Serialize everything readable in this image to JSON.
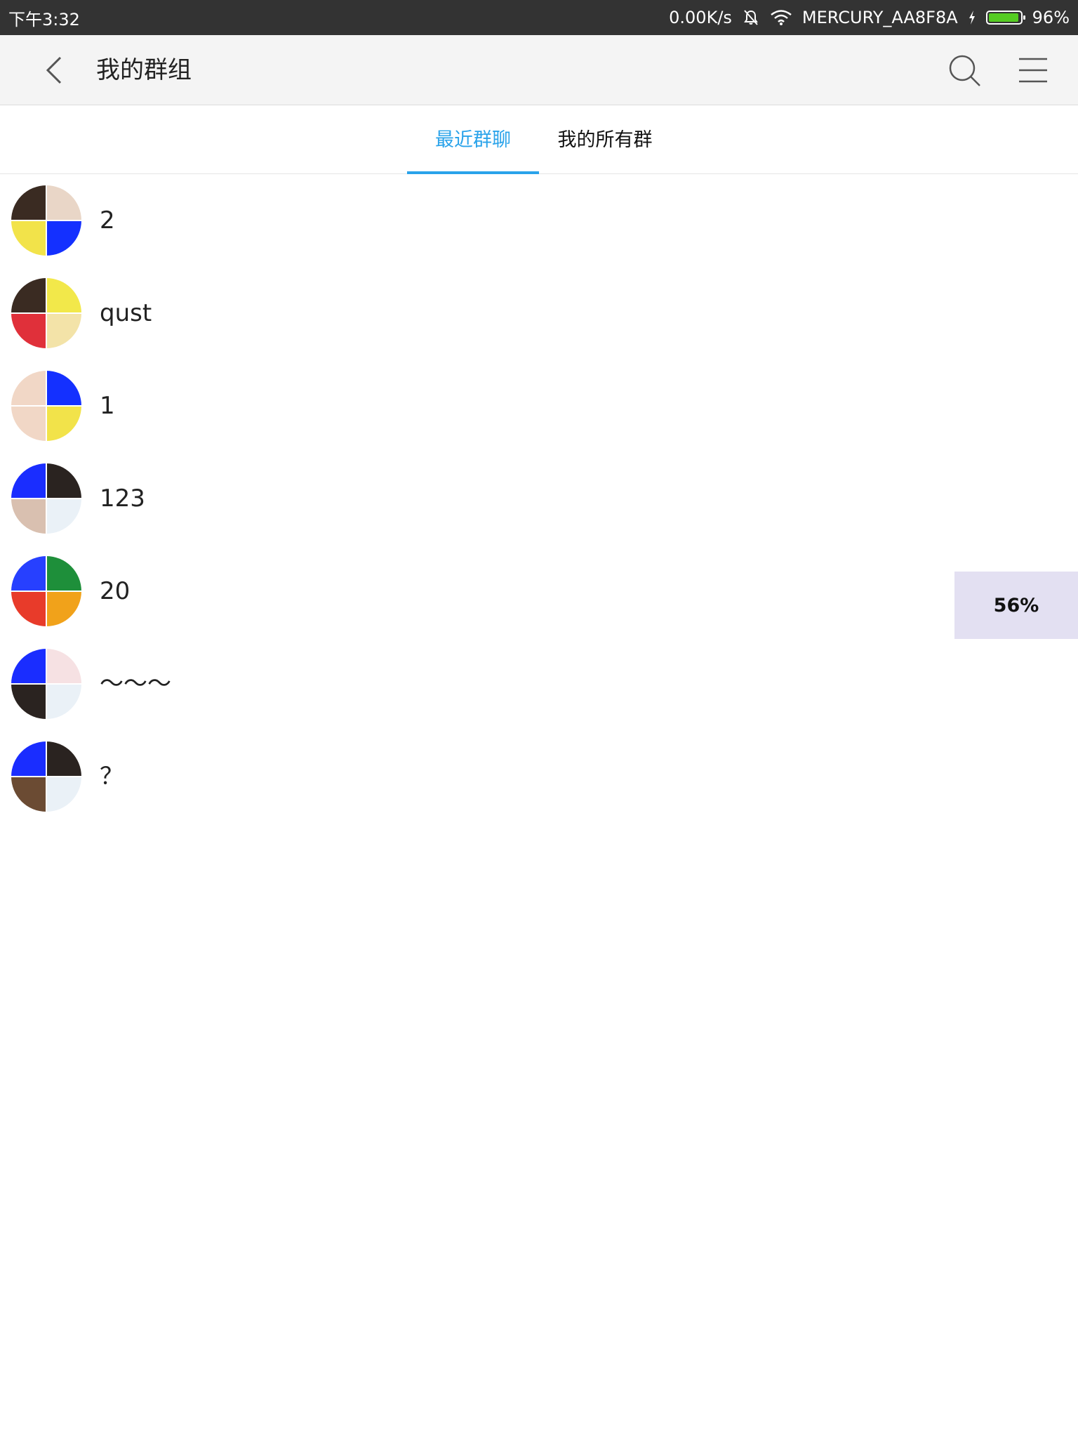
{
  "status_bar": {
    "time": "下午3:32",
    "net_speed": "0.00K/s",
    "wifi_name": "MERCURY_AA8F8A",
    "battery": "96%",
    "battery_level": 0.96,
    "icons": [
      "bell-off-icon",
      "wifi-icon",
      "charging-icon",
      "battery-icon"
    ]
  },
  "app_bar": {
    "title": "我的群组",
    "icons": [
      "back-arrow-icon",
      "search-icon",
      "menu-icon"
    ]
  },
  "tabs": [
    {
      "label": "最近群聊",
      "active": true
    },
    {
      "label": "我的所有群",
      "active": false
    }
  ],
  "colors": {
    "accent": "#2aa3ea",
    "status_bar_bg": "#333333",
    "app_bar_bg": "#f4f4f4",
    "battery_fill": "#55cc22",
    "progress_chip_bg": "#e3e0f2"
  },
  "groups": [
    {
      "name": "2",
      "avatar": [
        "#3a2b22",
        "#e9d6c7",
        "#f2e34a",
        "#1430ff"
      ]
    },
    {
      "name": "qust",
      "avatar": [
        "#3a2b22",
        "#f2e84a",
        "#e0303a",
        "#f3e3a8"
      ]
    },
    {
      "name": "1",
      "avatar": [
        "#f1d7c6",
        "#1430ff",
        "#f1d7c6",
        "#f2e34a"
      ]
    },
    {
      "name": "123",
      "avatar": [
        "#1a2dff",
        "#2a2320",
        "#d9c0b0",
        "#eaf1f7"
      ]
    },
    {
      "name": "20",
      "avatar": [
        "#2740ff",
        "#1e8f3a",
        "#e83b2a",
        "#f1a21a"
      ]
    },
    {
      "name": "～～～",
      "avatar": [
        "#1a2dff",
        "#f6e1e3",
        "#2a2320",
        "#eaf1f7"
      ]
    },
    {
      "name": "？",
      "avatar": [
        "#1a2dff",
        "#2a2320",
        "#6b4b33",
        "#eaf1f7"
      ]
    }
  ],
  "progress": {
    "label": "56%",
    "value": 0.56
  }
}
